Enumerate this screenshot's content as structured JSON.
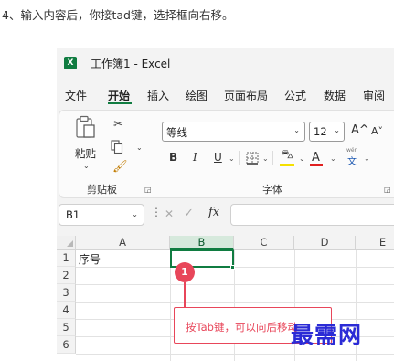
{
  "caption": "4、输入内容后，你接tad键，选择框向右移。",
  "window": {
    "app_badge": "X",
    "title": "工作簿1  -  Excel"
  },
  "menu": [
    "文件",
    "开始",
    "插入",
    "绘图",
    "页面布局",
    "公式",
    "数据",
    "审阅"
  ],
  "menu_active_index": 1,
  "clipboard": {
    "paste_label": "粘贴",
    "group_label": "剪贴板"
  },
  "font": {
    "name": "等线",
    "size": "12",
    "group_label": "字体",
    "bold": "B",
    "italic": "I",
    "underline": "U",
    "grow": "A^",
    "shrink": "A˅",
    "font_color_letter": "A",
    "phonetic": "文",
    "phonetic_top": "wén",
    "fill_color": "#f5e000",
    "font_color": "#e02020"
  },
  "formula_bar": {
    "name_box": "B1",
    "fx": "fx",
    "content": ""
  },
  "sheet": {
    "columns": [
      "A",
      "B",
      "C",
      "D",
      "E"
    ],
    "rows": [
      "1",
      "2",
      "3",
      "4",
      "5",
      "6"
    ],
    "selected_column": "B",
    "active_cell": "B1",
    "cells": {
      "A1": "序号"
    }
  },
  "annotation": {
    "marker": "1",
    "callout": "按Tab键，可以向后移动"
  },
  "watermark": "最需网",
  "colors": {
    "accent": "#107c41",
    "annotation": "#e8465a",
    "watermark": "#2b2bd6"
  }
}
